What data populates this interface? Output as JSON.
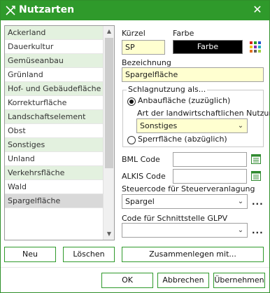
{
  "window": {
    "title": "Nutzarten",
    "icon": "crossed-tools-icon",
    "close_glyph": "✕",
    "accent_color": "#2f9a2b"
  },
  "list": {
    "items": [
      "Ackerland",
      "Dauerkultur",
      "Gemüseanbau",
      "Grünland",
      "Hof- und Gebäudefläche",
      "Korrekturfläche",
      "Landschaftselement",
      "Obst",
      "Sonstiges",
      "Unland",
      "Verkehrsfläche",
      "Wald",
      "Spargelfläche"
    ],
    "selected": "Spargelfläche"
  },
  "form": {
    "kuerzel_label": "Kürzel",
    "kuerzel_value": "SP",
    "farbe_label": "Farbe",
    "farbe_value": "Farbe",
    "bezeichnung_label": "Bezeichnung",
    "bezeichnung_value": "Spargelfläche",
    "group_label": "Schlagnutzung als...",
    "radio_anbau_label": "Anbaufläche (zuzüglich)",
    "radio_anbau_checked": true,
    "art_label": "Art der landwirtschaftlichen Nutzung",
    "art_value": "Sonstiges",
    "radio_sperr_label": "Sperrfläche (abzüglich)",
    "radio_sperr_checked": false,
    "bml_label": "BML Code",
    "bml_value": "",
    "alkis_label": "ALKIS Code",
    "alkis_value": "",
    "steuercode_label": "Steuercode für Steuerveranlagung",
    "steuercode_value": "Spargel",
    "glpv_label": "Code für Schnittstelle GLPV",
    "glpv_value": "",
    "more_glyph": "..."
  },
  "buttons": {
    "neu": "Neu",
    "loeschen": "Löschen",
    "zusammenlegen": "Zusammenlegen mit...",
    "ok": "OK",
    "abbrechen": "Abbrechen",
    "uebernehmen": "Übernehmen"
  }
}
